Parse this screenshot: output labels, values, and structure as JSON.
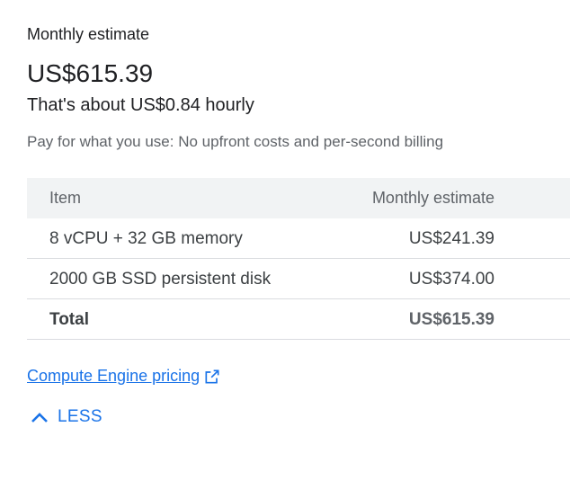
{
  "estimate": {
    "heading": "Monthly estimate",
    "total": "US$615.39",
    "hourly": "That's about US$0.84 hourly",
    "note": "Pay for what you use: No upfront costs and per-second billing"
  },
  "table": {
    "headers": {
      "item": "Item",
      "amount": "Monthly estimate"
    },
    "rows": [
      {
        "item": "8 vCPU + 32 GB memory",
        "amount": "US$241.39"
      },
      {
        "item": "2000 GB SSD persistent disk",
        "amount": "US$374.00"
      }
    ],
    "total": {
      "item": "Total",
      "amount": "US$615.39"
    }
  },
  "links": {
    "pricing": "Compute Engine pricing",
    "less": "LESS"
  },
  "colors": {
    "link": "#1a73e8",
    "header_bg": "#f1f3f4",
    "divider": "#dadce0"
  },
  "icons": {
    "pricing": "open-in-new-icon",
    "less": "chevron-up-icon"
  }
}
